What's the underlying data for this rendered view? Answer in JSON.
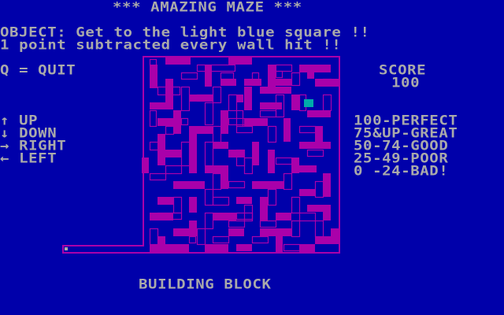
{
  "title": "*** AMAZING MAZE ***",
  "object_line": "OBJECT: Get to the light blue square !!",
  "penalty_line": "1 point subtracted every wall hit !!",
  "quit_label": "Q = QUIT",
  "score": {
    "label": "SCORE",
    "value": "100"
  },
  "controls": [
    {
      "icon": "up-arrow-icon",
      "glyph": "↑",
      "label": "UP"
    },
    {
      "icon": "down-arrow-icon",
      "glyph": "↓",
      "label": "DOWN"
    },
    {
      "icon": "right-arrow-icon",
      "glyph": "→",
      "label": "RIGHT"
    },
    {
      "icon": "left-arrow-icon",
      "glyph": "←",
      "label": "LEFT"
    }
  ],
  "ratings": [
    "100-PERFECT",
    "75&UP-GREAT",
    "50-74-GOOD",
    "25-49-POOR",
    "0 -24-BAD!"
  ],
  "maze_name": "BUILDING BLOCK",
  "colors": {
    "background": "#0000AA",
    "text": "#AAAAAA",
    "maze": "#AA00AA",
    "goal": "#00AAAA"
  }
}
